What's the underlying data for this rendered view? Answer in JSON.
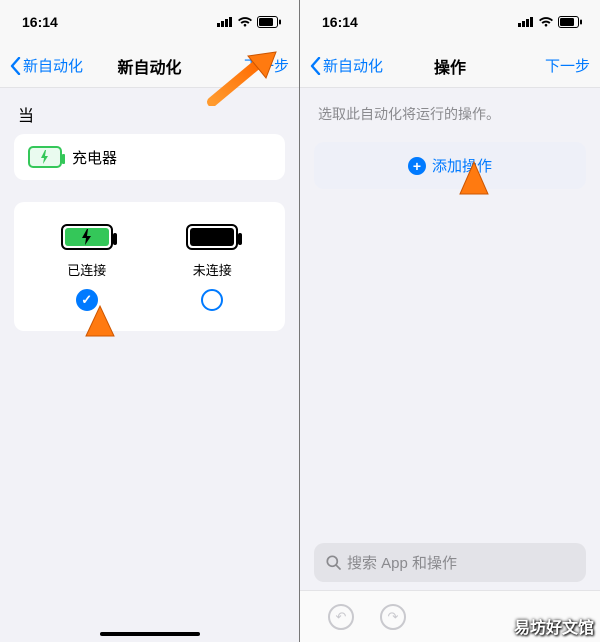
{
  "status": {
    "time": "16:14"
  },
  "left": {
    "nav": {
      "back": "新自动化",
      "title": "新自动化",
      "next": "下一步"
    },
    "section_label": "当",
    "trigger": {
      "label": "充电器"
    },
    "options": {
      "connected": "已连接",
      "disconnected": "未连接"
    }
  },
  "right": {
    "nav": {
      "back": "新自动化",
      "title": "操作",
      "next": "下一步"
    },
    "hint": "选取此自动化将运行的操作。",
    "add_action": "添加操作",
    "search_placeholder": "搜索 App 和操作"
  },
  "watermark": "易坊好文馆"
}
